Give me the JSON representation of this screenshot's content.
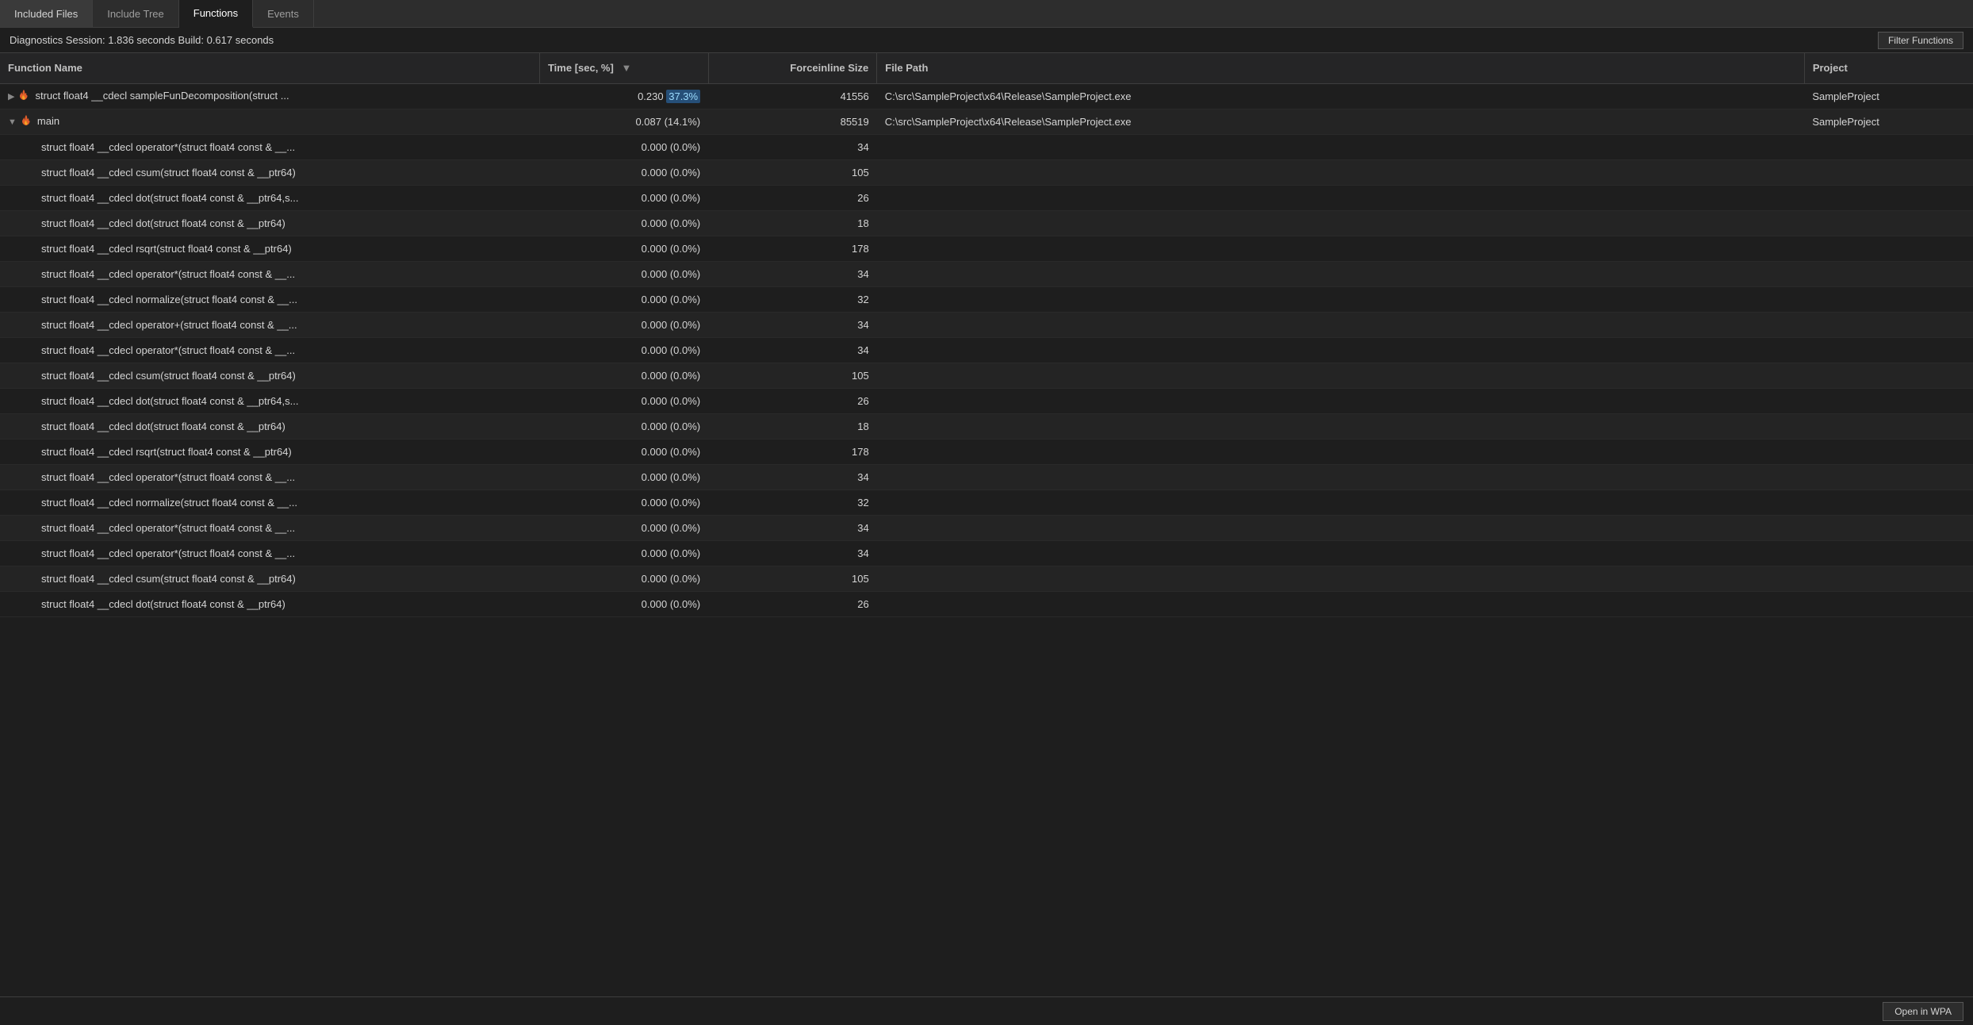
{
  "tabs": [
    {
      "id": "included-files",
      "label": "Included Files",
      "active": false
    },
    {
      "id": "include-tree",
      "label": "Include Tree",
      "active": false
    },
    {
      "id": "functions",
      "label": "Functions",
      "active": true
    },
    {
      "id": "events",
      "label": "Events",
      "active": false
    }
  ],
  "status": {
    "text": "Diagnostics Session: 1.836 seconds  Build: 0.617 seconds"
  },
  "filter_button": "Filter Functions",
  "columns": [
    {
      "id": "name",
      "label": "Function Name"
    },
    {
      "id": "time",
      "label": "Time [sec, %]",
      "sortable": true
    },
    {
      "id": "force",
      "label": "Forceinline Size"
    },
    {
      "id": "path",
      "label": "File Path"
    },
    {
      "id": "project",
      "label": "Project"
    }
  ],
  "rows": [
    {
      "indent": 0,
      "expandable": true,
      "expanded": false,
      "has_fire": true,
      "name": "struct float4 __cdecl sampleFunDecomposition(struct ...",
      "time": "0.230",
      "pct": "37.3%",
      "force": "41556",
      "path": "C:\\src\\SampleProject\\x64\\Release\\SampleProject.exe",
      "project": "SampleProject"
    },
    {
      "indent": 0,
      "expandable": true,
      "expanded": true,
      "has_fire": true,
      "name": "main",
      "time": "0.087",
      "pct": "14.1%",
      "force": "85519",
      "path": "C:\\src\\SampleProject\\x64\\Release\\SampleProject.exe",
      "project": "SampleProject"
    },
    {
      "indent": 1,
      "expandable": false,
      "has_fire": false,
      "name": "struct float4 __cdecl operator*(struct float4 const & __...",
      "time": "0.000",
      "pct": "0.0%",
      "force": "34",
      "path": "",
      "project": ""
    },
    {
      "indent": 1,
      "expandable": false,
      "has_fire": false,
      "name": "struct float4 __cdecl csum(struct float4 const & __ptr64)",
      "time": "0.000",
      "pct": "0.0%",
      "force": "105",
      "path": "",
      "project": ""
    },
    {
      "indent": 1,
      "expandable": false,
      "has_fire": false,
      "name": "struct float4 __cdecl dot(struct float4 const & __ptr64,s...",
      "time": "0.000",
      "pct": "0.0%",
      "force": "26",
      "path": "",
      "project": ""
    },
    {
      "indent": 1,
      "expandable": false,
      "has_fire": false,
      "name": "struct float4 __cdecl dot(struct float4 const & __ptr64)",
      "time": "0.000",
      "pct": "0.0%",
      "force": "18",
      "path": "",
      "project": ""
    },
    {
      "indent": 1,
      "expandable": false,
      "has_fire": false,
      "name": "struct float4 __cdecl rsqrt(struct float4 const & __ptr64)",
      "time": "0.000",
      "pct": "0.0%",
      "force": "178",
      "path": "",
      "project": ""
    },
    {
      "indent": 1,
      "expandable": false,
      "has_fire": false,
      "name": "struct float4 __cdecl operator*(struct float4 const & __...",
      "time": "0.000",
      "pct": "0.0%",
      "force": "34",
      "path": "",
      "project": ""
    },
    {
      "indent": 1,
      "expandable": false,
      "has_fire": false,
      "name": "struct float4 __cdecl normalize(struct float4 const & __...",
      "time": "0.000",
      "pct": "0.0%",
      "force": "32",
      "path": "",
      "project": ""
    },
    {
      "indent": 1,
      "expandable": false,
      "has_fire": false,
      "name": "struct float4 __cdecl operator+(struct float4 const & __...",
      "time": "0.000",
      "pct": "0.0%",
      "force": "34",
      "path": "",
      "project": ""
    },
    {
      "indent": 1,
      "expandable": false,
      "has_fire": false,
      "name": "struct float4 __cdecl operator*(struct float4 const & __...",
      "time": "0.000",
      "pct": "0.0%",
      "force": "34",
      "path": "",
      "project": ""
    },
    {
      "indent": 1,
      "expandable": false,
      "has_fire": false,
      "name": "struct float4 __cdecl csum(struct float4 const & __ptr64)",
      "time": "0.000",
      "pct": "0.0%",
      "force": "105",
      "path": "",
      "project": ""
    },
    {
      "indent": 1,
      "expandable": false,
      "has_fire": false,
      "name": "struct float4 __cdecl dot(struct float4 const & __ptr64,s...",
      "time": "0.000",
      "pct": "0.0%",
      "force": "26",
      "path": "",
      "project": ""
    },
    {
      "indent": 1,
      "expandable": false,
      "has_fire": false,
      "name": "struct float4 __cdecl dot(struct float4 const & __ptr64)",
      "time": "0.000",
      "pct": "0.0%",
      "force": "18",
      "path": "",
      "project": ""
    },
    {
      "indent": 1,
      "expandable": false,
      "has_fire": false,
      "name": "struct float4 __cdecl rsqrt(struct float4 const & __ptr64)",
      "time": "0.000",
      "pct": "0.0%",
      "force": "178",
      "path": "",
      "project": ""
    },
    {
      "indent": 1,
      "expandable": false,
      "has_fire": false,
      "name": "struct float4 __cdecl operator*(struct float4 const & __...",
      "time": "0.000",
      "pct": "0.0%",
      "force": "34",
      "path": "",
      "project": ""
    },
    {
      "indent": 1,
      "expandable": false,
      "has_fire": false,
      "name": "struct float4 __cdecl normalize(struct float4 const & __...",
      "time": "0.000",
      "pct": "0.0%",
      "force": "32",
      "path": "",
      "project": ""
    },
    {
      "indent": 1,
      "expandable": false,
      "has_fire": false,
      "name": "struct float4 __cdecl operator*(struct float4 const & __...",
      "time": "0.000",
      "pct": "0.0%",
      "force": "34",
      "path": "",
      "project": ""
    },
    {
      "indent": 1,
      "expandable": false,
      "has_fire": false,
      "name": "struct float4 __cdecl operator*(struct float4 const & __...",
      "time": "0.000",
      "pct": "0.0%",
      "force": "34",
      "path": "",
      "project": ""
    },
    {
      "indent": 1,
      "expandable": false,
      "has_fire": false,
      "name": "struct float4 __cdecl csum(struct float4 const & __ptr64)",
      "time": "0.000",
      "pct": "0.0%",
      "force": "105",
      "path": "",
      "project": ""
    },
    {
      "indent": 1,
      "expandable": false,
      "has_fire": false,
      "name": "struct float4 __cdecl dot(struct float4 const & __ptr64)",
      "time": "0.000",
      "pct": "0.0%",
      "force": "26",
      "path": "",
      "project": ""
    }
  ],
  "bottom_bar": {
    "open_wpa": "Open in WPA"
  }
}
